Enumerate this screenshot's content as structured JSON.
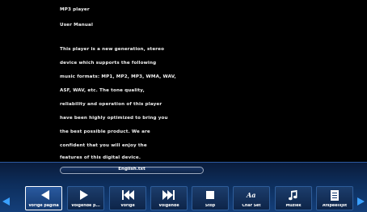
{
  "document": {
    "lines": [
      "MP3 player",
      "User Manual",
      "This player is a new generation, stereo",
      "device which supports the following",
      "music formats: MP1, MP2, MP3, WMA, WAV,",
      "ASF, WAV, etc. The tone quality,",
      "reliability and operation of this player",
      "have been highly optimized to bring you",
      "the best possible product. We are",
      "confident that you will enjoy the",
      "features of this digital device."
    ]
  },
  "filename": "English.txt",
  "toolbar": {
    "buttons": [
      {
        "label": "Vorige pagina",
        "icon": "previous-page-icon"
      },
      {
        "label": "Volgende p...",
        "icon": "next-page-icon"
      },
      {
        "label": "Vorige",
        "icon": "previous-track-icon"
      },
      {
        "label": "Volgende",
        "icon": "next-track-icon"
      },
      {
        "label": "Stop",
        "icon": "stop-icon"
      },
      {
        "label": "Char Set",
        "icon": "charset-icon"
      },
      {
        "label": "Muziek",
        "icon": "music-note-icon"
      },
      {
        "label": "Afspeellijst",
        "icon": "playlist-icon"
      }
    ],
    "selected_index": 0
  },
  "colors": {
    "toolbar_gradient_top": "#0a1b3a",
    "toolbar_gradient_bottom": "#143f7a",
    "nav_arrow": "#3aa0ff",
    "selected_border": "#ffffff"
  }
}
